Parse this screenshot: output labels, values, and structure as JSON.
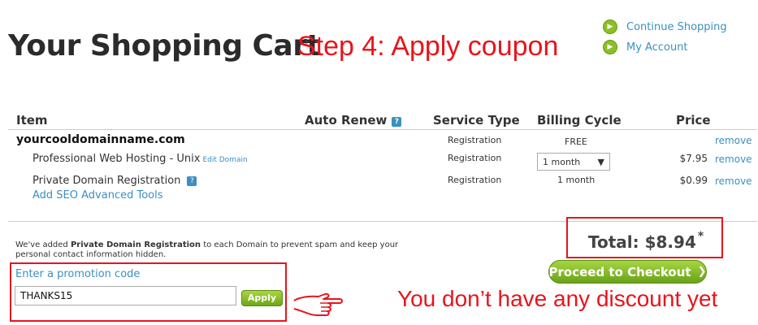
{
  "header": {
    "title": "Your Shopping Cart",
    "step_annotation": "Step 4: Apply coupon",
    "links": [
      {
        "label": "Continue Shopping",
        "icon": "arrow-circle-icon"
      },
      {
        "label": "My Account",
        "icon": "arrow-circle-icon"
      }
    ]
  },
  "table": {
    "headers": {
      "item": "Item",
      "auto_renew": "Auto Renew",
      "service_type": "Service Type",
      "billing_cycle": "Billing Cycle",
      "price": "Price"
    },
    "domain": "yourcooldomainname.com",
    "domain_row": {
      "service": "Registration",
      "cycle": "FREE",
      "remove": "remove"
    },
    "rows": [
      {
        "name": "Professional Web Hosting - Unix",
        "edit": "Edit Domain",
        "service": "Registration",
        "cycle": "1 month",
        "price": "$7.95",
        "remove": "remove"
      },
      {
        "name": "Private Domain Registration",
        "service": "Registration",
        "cycle": "1 month",
        "price": "$0.99",
        "remove": "remove"
      }
    ],
    "seo_link": "Add SEO Advanced Tools"
  },
  "notice": {
    "pre": "We've added ",
    "bold": "Private Domain Registration",
    "post": " to each Domain to prevent spam and keep your personal contact information hidden."
  },
  "promo": {
    "label": "Enter a promotion code",
    "value": "THANKS15",
    "apply_label": "Apply"
  },
  "total": {
    "label": "Total: $8.94",
    "asterisk": "*"
  },
  "checkout_label": "Proceed to Checkout",
  "discount_annotation": "You don’t have any discount yet",
  "colors": {
    "accent_green": "#7db521",
    "link_blue": "#3a90c0",
    "annotation_red": "#e8141c"
  }
}
